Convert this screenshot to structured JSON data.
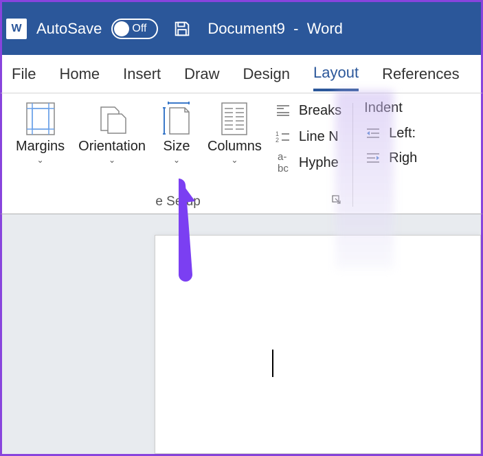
{
  "titlebar": {
    "autosave_label": "AutoSave",
    "autosave_state": "Off",
    "document_name": "Document9",
    "separator": "-",
    "app_name": "Word"
  },
  "tabs": {
    "file": "File",
    "home": "Home",
    "insert": "Insert",
    "draw": "Draw",
    "design": "Design",
    "layout": "Layout",
    "references": "References"
  },
  "ribbon": {
    "page_setup": {
      "margins": "Margins",
      "orientation": "Orientation",
      "size": "Size",
      "columns": "Columns",
      "breaks": "Breaks",
      "line_numbers": "Line N",
      "hyphenation": "Hyphe",
      "group_label": "e Setup"
    },
    "paragraph": {
      "indent_title": "Indent",
      "left": "Left:",
      "right": "Righ"
    }
  }
}
